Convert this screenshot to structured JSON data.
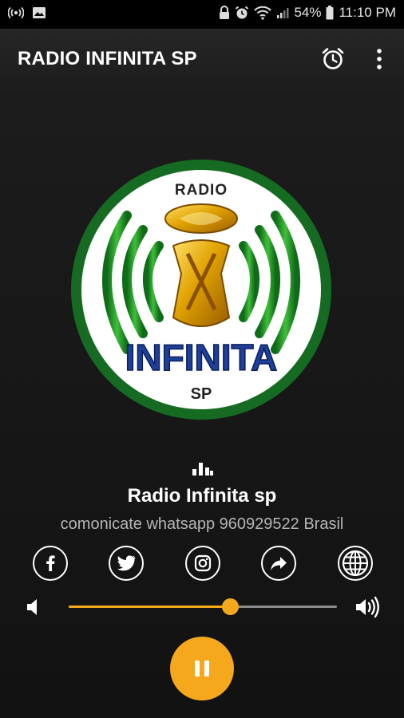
{
  "status_bar": {
    "battery_percent": "54%",
    "time": "11:10 PM"
  },
  "app_bar": {
    "title": "RADIO INFINITA SP",
    "icons": [
      "alarm-icon",
      "more-vert-icon"
    ]
  },
  "logo": {
    "top_text": "RADIO",
    "main_text": "INFINITA",
    "bottom_text": "SP"
  },
  "station": {
    "name": "Radio Infinita sp",
    "description": "comonicate whatsapp 960929522 Brasil"
  },
  "social_icons": [
    "facebook-icon",
    "twitter-icon",
    "instagram-icon",
    "share-icon",
    "globe-icon"
  ],
  "volume": {
    "level": 0.6
  },
  "player": {
    "state": "playing",
    "button_icon": "pause-icon"
  },
  "colors": {
    "accent": "#f5a81c",
    "logo_green": "#1f8f2c",
    "logo_blue": "#1e3f9a",
    "logo_gold": "#e0a200"
  }
}
